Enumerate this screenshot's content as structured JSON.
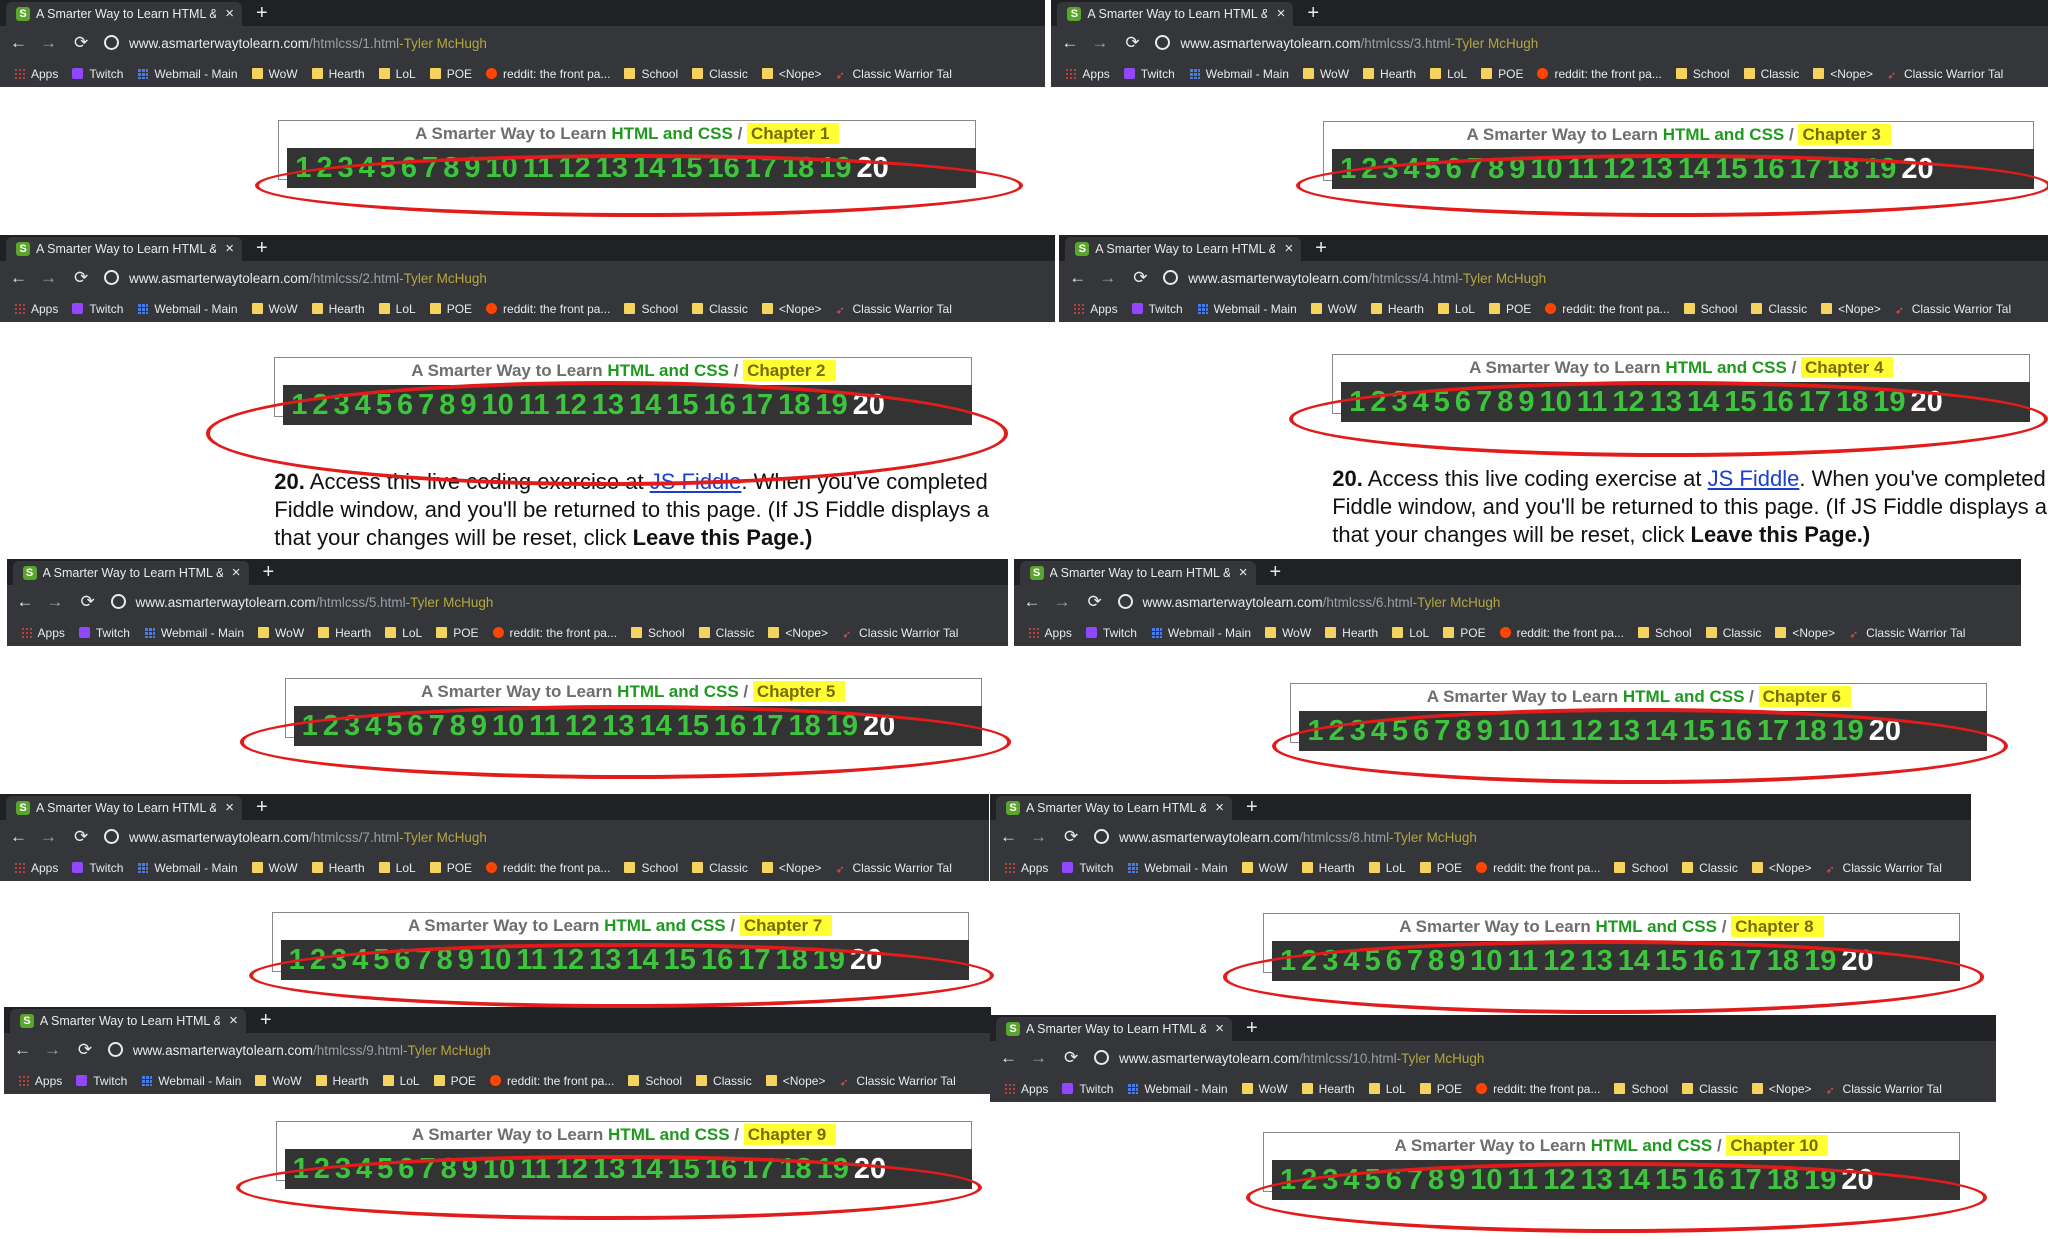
{
  "window": {
    "tab_title": "A Smarter Way to Learn HTML &",
    "tab_close": "×",
    "new_tab": "+",
    "favicon": "S"
  },
  "nav": {
    "back": "←",
    "forward": "→",
    "reload": "⟳"
  },
  "bookmarks": [
    {
      "label": "Apps",
      "icon": "apps-icon"
    },
    {
      "label": "Twitch",
      "icon": "twitch-icon"
    },
    {
      "label": "Webmail - Main",
      "icon": "grid-icon"
    },
    {
      "label": "WoW",
      "icon": "folder-icon"
    },
    {
      "label": "Hearth",
      "icon": "folder-icon"
    },
    {
      "label": "LoL",
      "icon": "folder-icon"
    },
    {
      "label": "POE",
      "icon": "folder-icon"
    },
    {
      "label": "reddit: the front pa...",
      "icon": "reddit-icon"
    },
    {
      "label": "School",
      "icon": "folder-icon"
    },
    {
      "label": "Classic",
      "icon": "folder-icon"
    },
    {
      "label": "<Nope>",
      "icon": "folder-icon"
    },
    {
      "label": "Classic Warrior Tal",
      "icon": "rocket-icon"
    }
  ],
  "page_heading": {
    "prefix": "A Smarter Way to Learn ",
    "highlight": "HTML and CSS",
    "separator": " / "
  },
  "numbers": [
    "1",
    "2",
    "3",
    "4",
    "5",
    "6",
    "7",
    "8",
    "9",
    "10",
    "11",
    "12",
    "13",
    "14",
    "15",
    "16",
    "17",
    "18",
    "19",
    "20"
  ],
  "exercise": {
    "number": "20.",
    "line1_before": " Access this live coding exercise at ",
    "link": "JS Fiddle",
    "line1_after": ". When you've completed",
    "line2": "Fiddle window, and you'll be returned to this page. (If JS Fiddle displays a",
    "line3_before": "that your changes will be reset, click ",
    "line3_bold": "Leave this Page.)"
  },
  "panels": [
    {
      "host": "www.asmarterwaytolearn.com",
      "path": "/htmlcss/1.html",
      "suffix": "-Tyler McHugh",
      "chapter": "Chapter 1"
    },
    {
      "host": "www.asmarterwaytolearn.com",
      "path": "/htmlcss/3.html",
      "suffix": "-Tyler McHugh",
      "chapter": "Chapter 3"
    },
    {
      "host": "www.asmarterwaytolearn.com",
      "path": "/htmlcss/2.html",
      "suffix": "-Tyler McHugh",
      "chapter": "Chapter 2"
    },
    {
      "host": "www.asmarterwaytolearn.com",
      "path": "/htmlcss/4.html",
      "suffix": "-Tyler McHugh",
      "chapter": "Chapter 4"
    },
    {
      "host": "www.asmarterwaytolearn.com",
      "path": "/htmlcss/5.html",
      "suffix": "-Tyler McHugh",
      "chapter": "Chapter 5"
    },
    {
      "host": "www.asmarterwaytolearn.com",
      "path": "/htmlcss/6.html",
      "suffix": "-Tyler McHugh",
      "chapter": "Chapter 6"
    },
    {
      "host": "www.asmarterwaytolearn.com",
      "path": "/htmlcss/7.html",
      "suffix": "-Tyler McHugh",
      "chapter": "Chapter 7"
    },
    {
      "host": "www.asmarterwaytolearn.com",
      "path": "/htmlcss/8.html",
      "suffix": "-Tyler McHugh",
      "chapter": "Chapter 8"
    },
    {
      "host": "www.asmarterwaytolearn.com",
      "path": "/htmlcss/9.html",
      "suffix": "-Tyler McHugh",
      "chapter": "Chapter 9"
    },
    {
      "host": "www.asmarterwaytolearn.com",
      "path": "/htmlcss/10.html",
      "suffix": "-Tyler McHugh",
      "chapter": "Chapter 10"
    }
  ],
  "colors": {
    "tab_bar": "#202124",
    "toolbar": "#35363a",
    "heading_green": "#1f9a1f",
    "chapter_highlight": "#ffff33",
    "number_green": "#3cc43c",
    "number_bar": "#333333",
    "annotation_red": "#e21b1b"
  }
}
